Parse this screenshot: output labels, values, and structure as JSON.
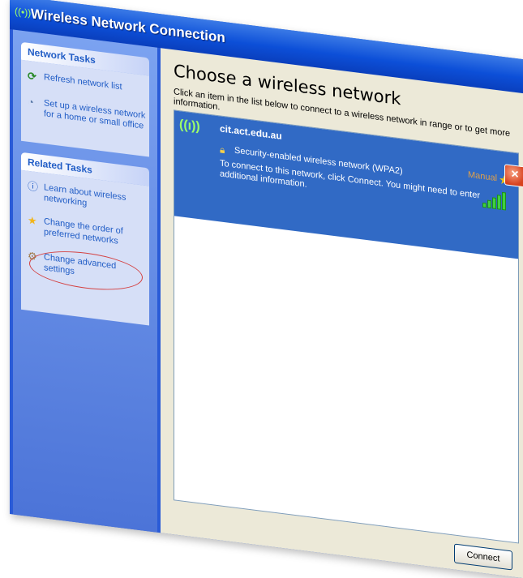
{
  "window": {
    "title": "Wireless Network Connection",
    "title_icon": "wireless-network-icon",
    "close_icon": "close-icon"
  },
  "sidebar": {
    "network_tasks": {
      "header": "Network Tasks",
      "items": [
        {
          "label": "Refresh network list",
          "icon": "refresh-icon"
        },
        {
          "label": "Set up a wireless network for a home or small office",
          "icon": "wireless-setup-icon"
        }
      ]
    },
    "related_tasks": {
      "header": "Related Tasks",
      "items": [
        {
          "label": "Learn about wireless networking",
          "icon": "info-icon"
        },
        {
          "label": "Change the order of preferred networks",
          "icon": "star-icon"
        },
        {
          "label": "Change advanced settings",
          "icon": "settings-icon",
          "highlighted": true
        }
      ]
    }
  },
  "main": {
    "heading": "Choose a wireless network",
    "instruction": "Click an item in the list below to connect to a wireless network in range or to get more information.",
    "networks": [
      {
        "name": "cit.act.edu.au",
        "security": "Security-enabled wireless network (WPA2)",
        "description": "To connect to this network, click Connect. You might need to enter additional information.",
        "status": "Manual",
        "signal_bars": 5,
        "selected": true
      }
    ],
    "connect_label": "Connect"
  },
  "colors": {
    "titlebar": "#0c4fd8",
    "sidebar": "#6a8ee6",
    "selection": "#316ac5",
    "content_bg": "#ece9d8",
    "annotation": "#d44040"
  }
}
